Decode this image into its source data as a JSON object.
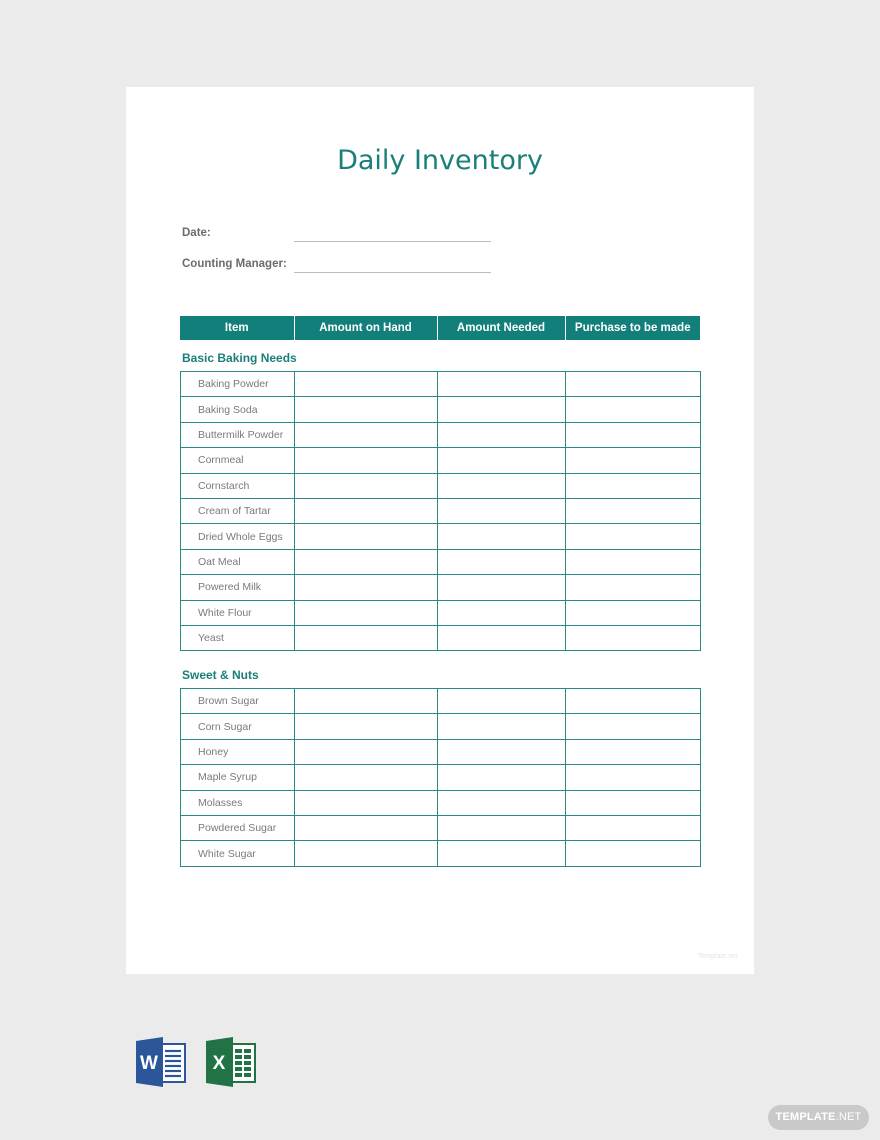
{
  "document": {
    "title": "Daily Inventory",
    "fields": [
      {
        "label": "Date:",
        "value": ""
      },
      {
        "label": "Counting Manager:",
        "value": ""
      }
    ],
    "columns": [
      "Item",
      "Amount on Hand",
      "Amount Needed",
      "Purchase to be made"
    ],
    "sections": [
      {
        "title": "Basic Baking Needs",
        "items": [
          "Baking Powder",
          "Baking Soda",
          "Buttermilk Powder",
          "Cornmeal",
          "Cornstarch",
          "Cream of Tartar",
          "Dried Whole Eggs",
          "Oat Meal",
          "Powered Milk",
          "White Flour",
          "Yeast"
        ]
      },
      {
        "title": "Sweet & Nuts",
        "items": [
          "Brown Sugar",
          "Corn Sugar",
          "Honey",
          "Maple Syrup",
          "Molasses",
          "Powdered Sugar",
          "White Sugar"
        ]
      }
    ],
    "watermark": "Template.net"
  },
  "formats": [
    {
      "name": "word-icon",
      "letter": "W",
      "color": "#2b579a"
    },
    {
      "name": "excel-icon",
      "letter": "X",
      "color": "#217346"
    }
  ],
  "badge": {
    "label_bold": "TEMPLATE",
    "label_rest": ".NET"
  },
  "colors": {
    "accent": "#137f7b",
    "background": "#ebebeb"
  }
}
